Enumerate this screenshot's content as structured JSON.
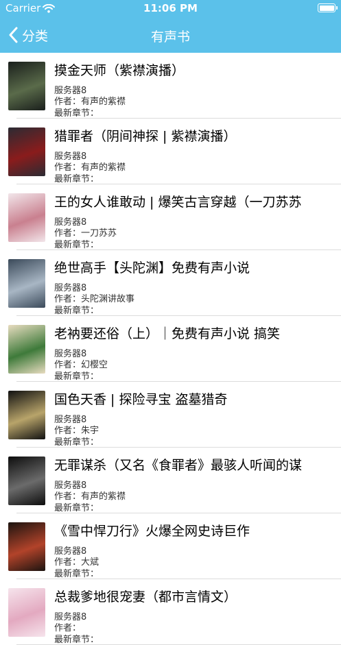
{
  "status_bar": {
    "carrier": "Carrier",
    "time": "11:06 PM"
  },
  "nav": {
    "back_label": "分类",
    "title": "有声书"
  },
  "labels": {
    "author_prefix": "作者：",
    "latest_label": "最新章节："
  },
  "books": [
    {
      "title": "摸金天师（紫襟演播）",
      "server": "服务器8",
      "author": "有声的紫襟",
      "cover_colors": [
        "#1a1f1c",
        "#5a6b4a"
      ]
    },
    {
      "title": "猎罪者（阴间神探 | 紫襟演播）",
      "server": "服务器8",
      "author": "有声的紫襟",
      "cover_colors": [
        "#2b2b33",
        "#8a1c1c"
      ]
    },
    {
      "title": "王的女人谁敢动 | 爆笑古言穿越（一刀苏苏",
      "server": "服务器8",
      "author": "一刀苏苏",
      "cover_colors": [
        "#f2e6ea",
        "#c9808f"
      ]
    },
    {
      "title": "绝世高手【头陀渊】免费有声小说",
      "server": "服务器8",
      "author": "头陀渊讲故事",
      "cover_colors": [
        "#3b4a5a",
        "#a8b6c4"
      ]
    },
    {
      "title": "老衲要还俗（上）｜免费有声小说 搞笑",
      "server": "服务器8",
      "author": "幻樱空",
      "cover_colors": [
        "#e8dcc0",
        "#3e7a3a"
      ]
    },
    {
      "title": "国色天香 | 探险寻宝 盗墓猎奇",
      "server": "服务器8",
      "author": "朱宇",
      "cover_colors": [
        "#111111",
        "#b8a46a"
      ]
    },
    {
      "title": "无罪谋杀（又名《食罪者》最骇人听闻的谋",
      "server": "服务器8",
      "author": "有声的紫襟",
      "cover_colors": [
        "#0d0d0d",
        "#6b6b6b"
      ]
    },
    {
      "title": "《雪中悍刀行》火爆全网史诗巨作",
      "server": "服务器8",
      "author": "大斌",
      "cover_colors": [
        "#1c1410",
        "#b2432a"
      ]
    },
    {
      "title": "总裁爹地很宠妻（都市言情文）",
      "server": "服务器8",
      "author": "",
      "cover_colors": [
        "#f6e4ec",
        "#e3a9c0"
      ]
    }
  ]
}
